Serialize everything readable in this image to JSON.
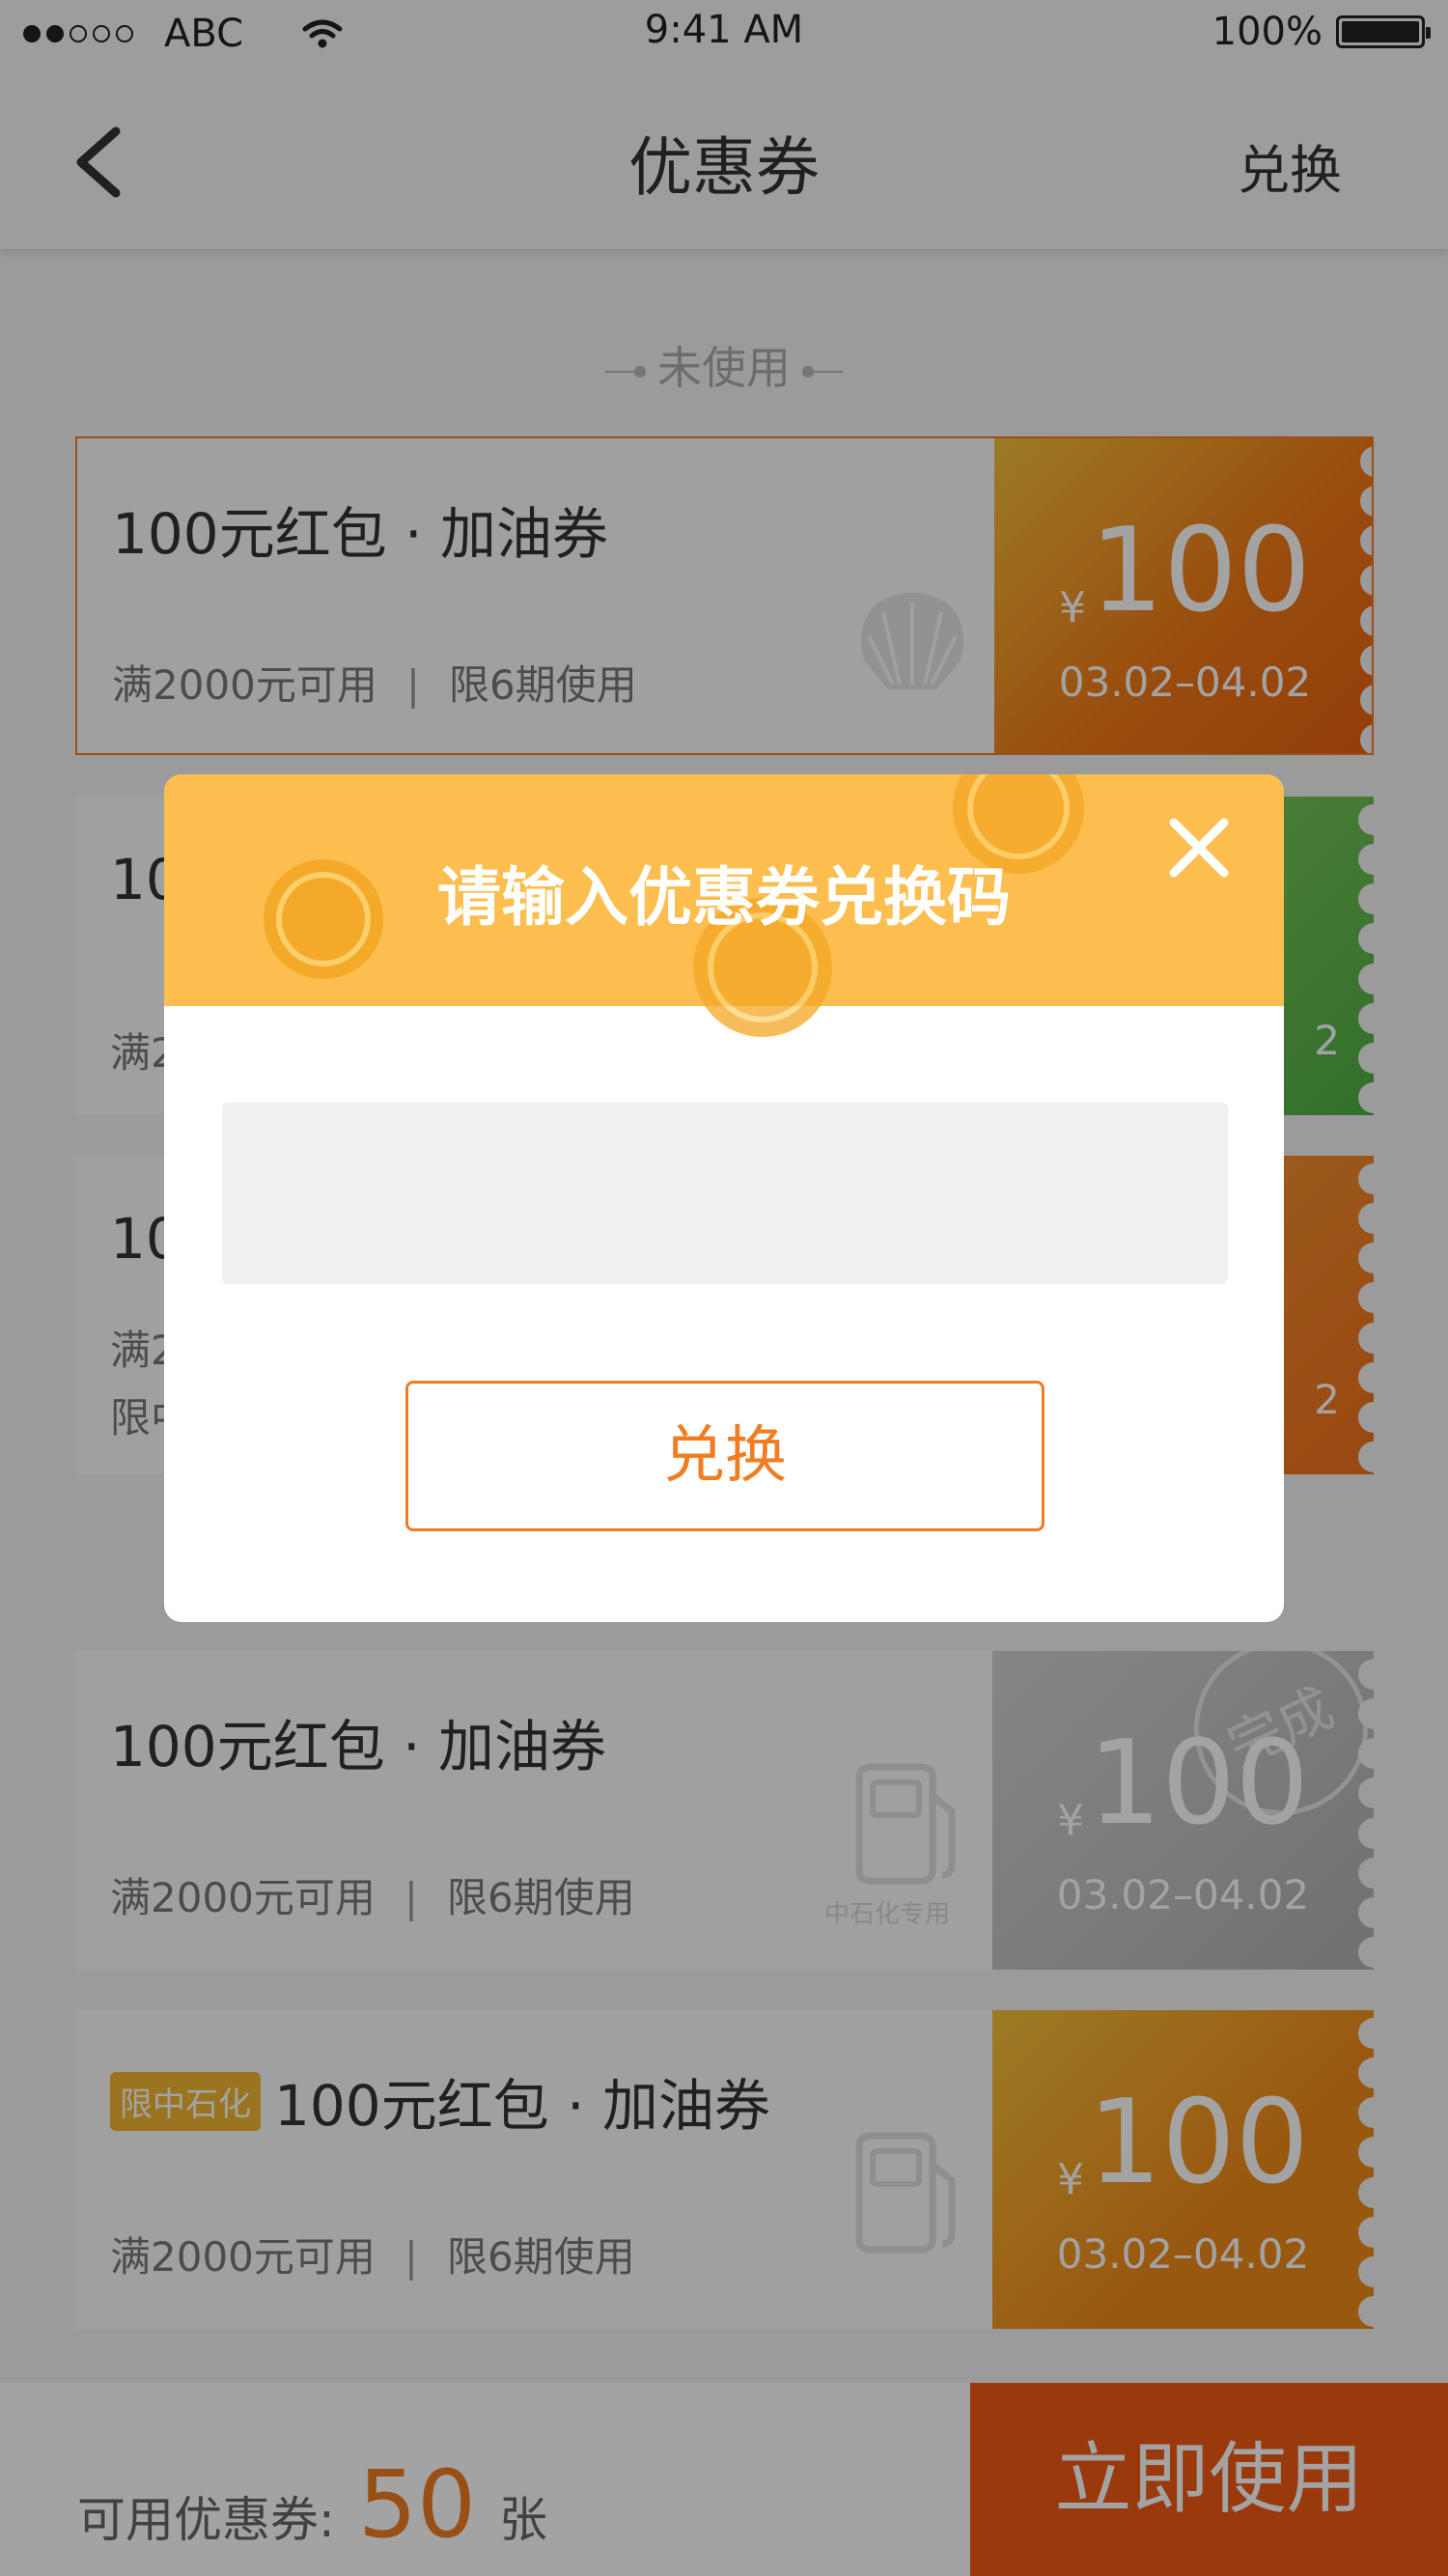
{
  "status_bar": {
    "carrier": "ABC",
    "time": "9:41 AM",
    "battery": "100%"
  },
  "nav": {
    "title": "优惠券",
    "right_action": "兑换"
  },
  "section_label": "未使用",
  "coupons": [
    {
      "title": "100元红包 · 加油券",
      "condition": "满2000元可用",
      "limit": "限6期使用",
      "amount": "100",
      "yen": "¥",
      "date": "03.02–04.02",
      "color": "#f08a1a"
    },
    {
      "title": "10",
      "condition": "满2",
      "limit": "",
      "amount": "",
      "yen": "",
      "date": "2",
      "color": "#57b049"
    },
    {
      "title": "10",
      "condition": "满2",
      "limit": "限中",
      "amount": "",
      "yen": "",
      "date": "2",
      "color": "#f07f20"
    },
    {
      "title": "100元红包 · 加油券",
      "condition": "满2000元可用",
      "limit": "限6期使用",
      "amount": "100",
      "yen": "¥",
      "date": "03.02–04.02",
      "stamp": "完成",
      "watermark_label": "中石化专用",
      "color": "#bdbdbd"
    },
    {
      "badge": "限中石化",
      "title": "100元红包 · 加油券",
      "condition": "满2000元可用",
      "limit": "限6期使用",
      "amount": "100",
      "yen": "¥",
      "date": "03.02–04.02",
      "color": "#f08a1a"
    }
  ],
  "bottom": {
    "label": "可用优惠券:",
    "count": "50",
    "unit": "张",
    "button": "立即使用"
  },
  "modal": {
    "title": "请输入优惠券兑换码",
    "input_value": "",
    "input_placeholder": "",
    "button": "兑换"
  },
  "colors": {
    "accent": "#ef7d23",
    "modal_header": "#fbbe4f",
    "use_button": "#f05a13"
  },
  "icons": [
    "back-chevron-icon",
    "wifi-icon",
    "battery-icon",
    "close-icon",
    "coin-icon",
    "gas-pump-icon",
    "shell-logo-icon"
  ]
}
